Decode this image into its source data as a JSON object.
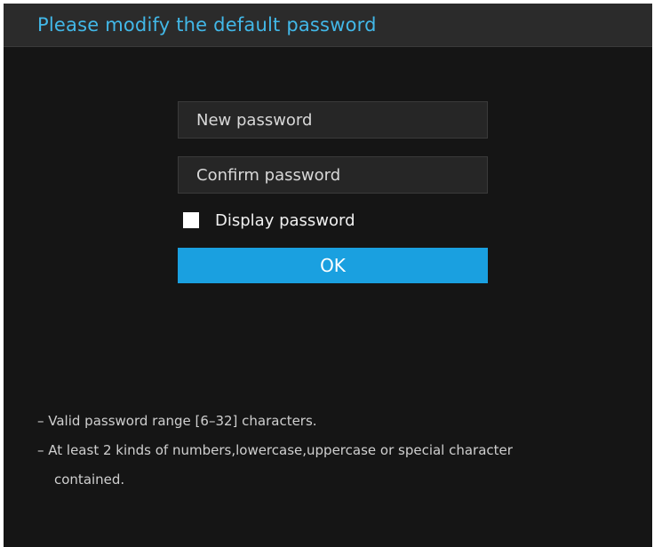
{
  "dialog": {
    "title": "Please modify the default password"
  },
  "form": {
    "new_password_placeholder": "New password",
    "confirm_password_placeholder": "Confirm password",
    "display_password_label": "Display password",
    "display_password_checked": false,
    "ok_label": "OK"
  },
  "hints": {
    "line1": "– Valid password range [6–32] characters.",
    "line2": "– At least 2 kinds of numbers,lowercase,uppercase or special character",
    "line3": "contained."
  },
  "colors": {
    "title": "#42b8e8",
    "ok_button": "#1aa0e0",
    "background": "#151515",
    "titlebar": "#2b2b2b"
  }
}
